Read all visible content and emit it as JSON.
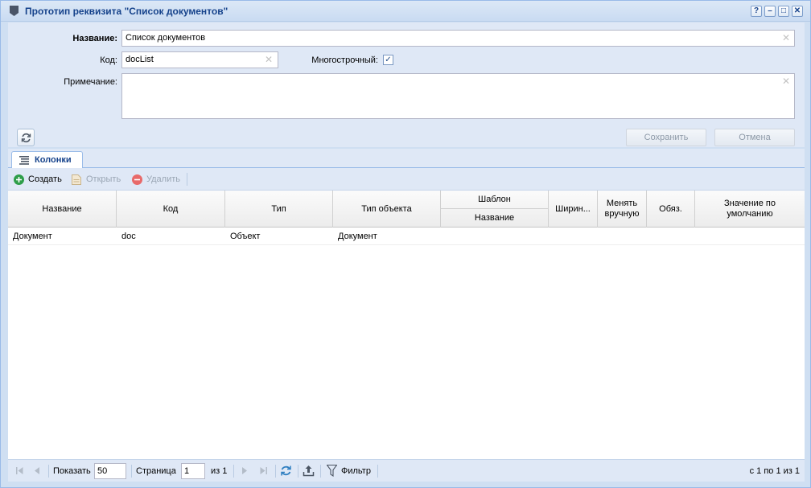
{
  "window": {
    "title": "Прототип реквизита \"Список документов\"",
    "buttons": {
      "help": "?",
      "minimize": "–",
      "maximize": "□",
      "close": "✕"
    }
  },
  "form": {
    "name_label": "Название:",
    "name_value": "Список документов",
    "code_label": "Код:",
    "code_value": "docList",
    "multiline_label": "Многострочный:",
    "multiline_checked": true,
    "note_label": "Примечание:",
    "note_value": "",
    "save_label": "Сохранить",
    "cancel_label": "Отмена"
  },
  "tabs": [
    {
      "label": "Колонки",
      "active": true
    }
  ],
  "toolbar": {
    "create": "Создать",
    "open": "Открыть",
    "delete": "Удалить"
  },
  "grid": {
    "columns": {
      "name": "Название",
      "code": "Код",
      "type": "Тип",
      "object_type": "Тип объекта",
      "template": "Шаблон",
      "template_name": "Название",
      "width": "Ширин...",
      "manual_1": "Менять",
      "manual_2": "вручную",
      "required": "Обяз.",
      "default_1": "Значение по",
      "default_2": "умолчанию"
    },
    "rows": [
      {
        "name": "Документ",
        "code": "doc",
        "type": "Объект",
        "object_type": "Документ",
        "template_name": "",
        "width": "",
        "manual": "",
        "required": "",
        "default": ""
      }
    ]
  },
  "pager": {
    "show_label": "Показать",
    "page_size": "50",
    "page_label": "Страница",
    "page_value": "1",
    "of_label": "из 1",
    "filter_label": "Фильтр",
    "summary": "с 1 по 1 из 1"
  },
  "colors": {
    "accent": "#15428b",
    "panel": "#dfe8f6",
    "border": "#99bbe8",
    "create_icon": "#2e9e4a",
    "delete_icon": "#e86a6a"
  }
}
